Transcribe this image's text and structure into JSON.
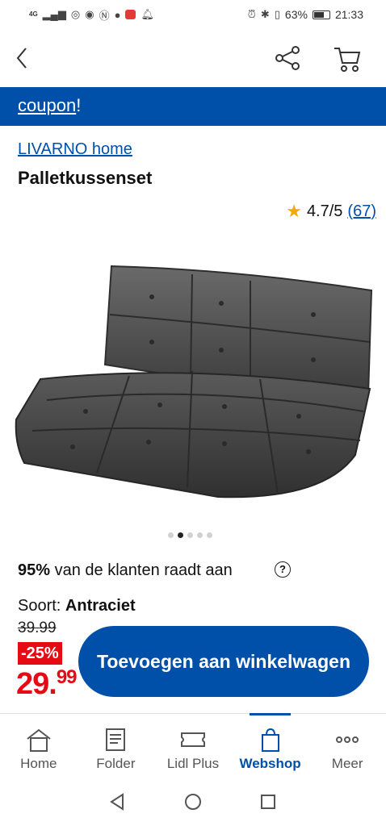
{
  "status_bar": {
    "network": "4G",
    "battery": "63%",
    "time": "21:33"
  },
  "banner": {
    "text": "coupon",
    "suffix": "!"
  },
  "product": {
    "brand": "LIVARNO home",
    "title": "Palletkussenset",
    "rating": "4.7/5",
    "review_count": "(67)",
    "image_icon": "grey-pallet-cushion-image",
    "gallery_dots": 5,
    "gallery_active": 2,
    "recommend_pct": "95%",
    "recommend_text": "van de klanten raadt aan",
    "help_symbol": "?",
    "variant_label": "Soort:",
    "variant_value": "Antraciet"
  },
  "price": {
    "old": "39.99",
    "discount": "-25%",
    "current_int": "29.",
    "current_dec": "99",
    "add_to_cart": "Toevoegen aan winkelwagen"
  },
  "tabs": [
    {
      "label": "Home",
      "icon": "home-icon"
    },
    {
      "label": "Folder",
      "icon": "folder-icon"
    },
    {
      "label": "Lidl Plus",
      "icon": "ticket-icon"
    },
    {
      "label": "Webshop",
      "icon": "shopping-bag-icon",
      "active": true
    },
    {
      "label": "Meer",
      "icon": "more-icon"
    }
  ],
  "colors": {
    "brand_blue": "#0050aa",
    "sale_red": "#e60a14",
    "star": "#f2a900"
  }
}
